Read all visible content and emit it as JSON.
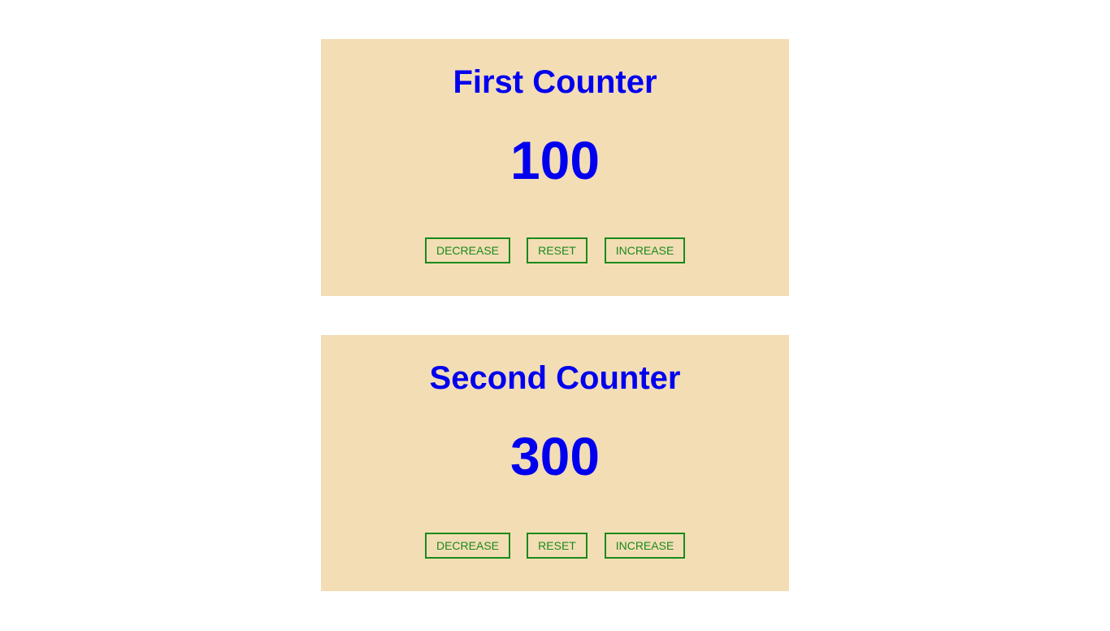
{
  "colors": {
    "card_background": "#f3ddb5",
    "title_and_value": "#0000ee",
    "button_text_and_border": "#1a8a1a",
    "page_background": "#ffffff"
  },
  "counters": [
    {
      "title": "First Counter",
      "value": "100",
      "buttons": {
        "decrease": "DECREASE",
        "reset": "RESET",
        "increase": "INCREASE"
      }
    },
    {
      "title": "Second Counter",
      "value": "300",
      "buttons": {
        "decrease": "DECREASE",
        "reset": "RESET",
        "increase": "INCREASE"
      }
    }
  ]
}
